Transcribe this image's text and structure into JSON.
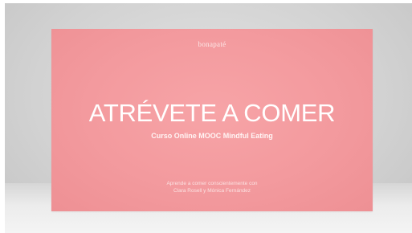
{
  "card": {
    "brand": "bonapaté",
    "title": "ATRÉVETE A COMER",
    "subtitle": "Curso Online MOOC Mindful Eating",
    "footer_line1": "Aprende a comer conscientemente con",
    "footer_line2": "Clara Rosell y Mónica Fernández"
  },
  "colors": {
    "card_background": "#f39a9e",
    "backdrop": "#d2d2d2",
    "text": "#ffffff"
  }
}
